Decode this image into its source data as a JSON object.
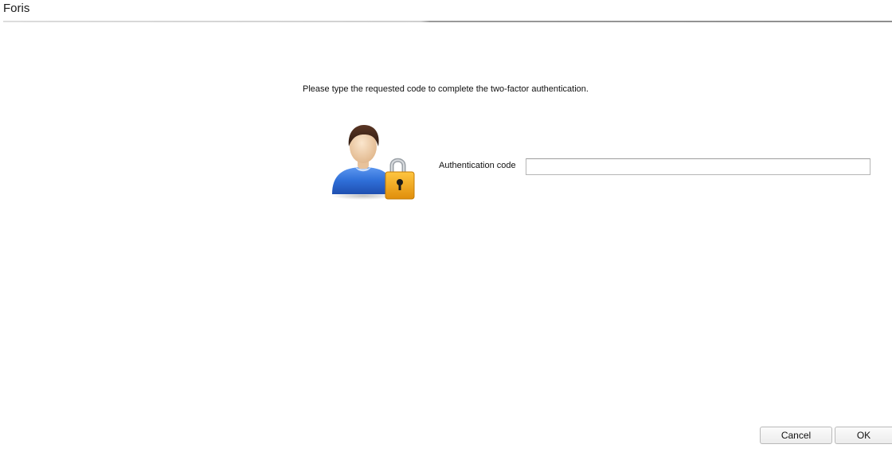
{
  "window": {
    "title": "Foris"
  },
  "dialog": {
    "instruction": "Please type the requested code to complete the two-factor authentication.",
    "icon": "user-with-padlock-icon",
    "field_label": "Authentication code",
    "field_value": "",
    "field_placeholder": ""
  },
  "buttons": {
    "cancel_label": "Cancel",
    "ok_label": "OK"
  },
  "colors": {
    "user_shirt": "#2f6fd8",
    "padlock_body": "#f0a418"
  }
}
